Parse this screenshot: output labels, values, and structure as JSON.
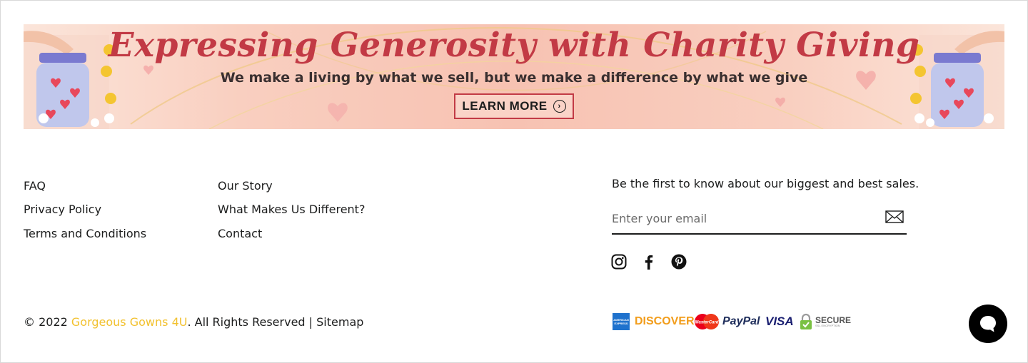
{
  "banner": {
    "title": "Expressing Generosity with Charity Giving",
    "subtitle": "We make a living by what we sell, but we make a difference by what we give",
    "button_label": "LEARN MORE",
    "colors": {
      "title": "#c23a45",
      "background": "#f7c2b2"
    }
  },
  "footer": {
    "col1": [
      "FAQ",
      "Privacy Policy",
      "Terms and Conditions"
    ],
    "col2": [
      "Our Story",
      "What Makes Us Different?",
      "Contact"
    ],
    "newsletter": {
      "text": "Be the first to know about our biggest and best sales.",
      "placeholder": "Enter your email",
      "submit_icon": "envelope-icon"
    },
    "social": [
      "instagram-icon",
      "facebook-icon",
      "pinterest-icon"
    ],
    "copyright": {
      "prefix": "© 2022 ",
      "brand": "Gorgeous Gowns 4U",
      "suffix": ". All Rights Reserved | ",
      "sitemap": "Sitemap",
      "brand_color": "#f2c12e"
    },
    "payment": {
      "amex": "AMERICAN EXPRESS",
      "discover": "DISCOVER",
      "mastercard": "MasterCard",
      "paypal": "PayPal",
      "visa": "VISA",
      "secure": "SECURE",
      "secure_sub": "SSL ENCRYPTION"
    }
  },
  "chat": {
    "icon": "chat-bubble-icon"
  }
}
